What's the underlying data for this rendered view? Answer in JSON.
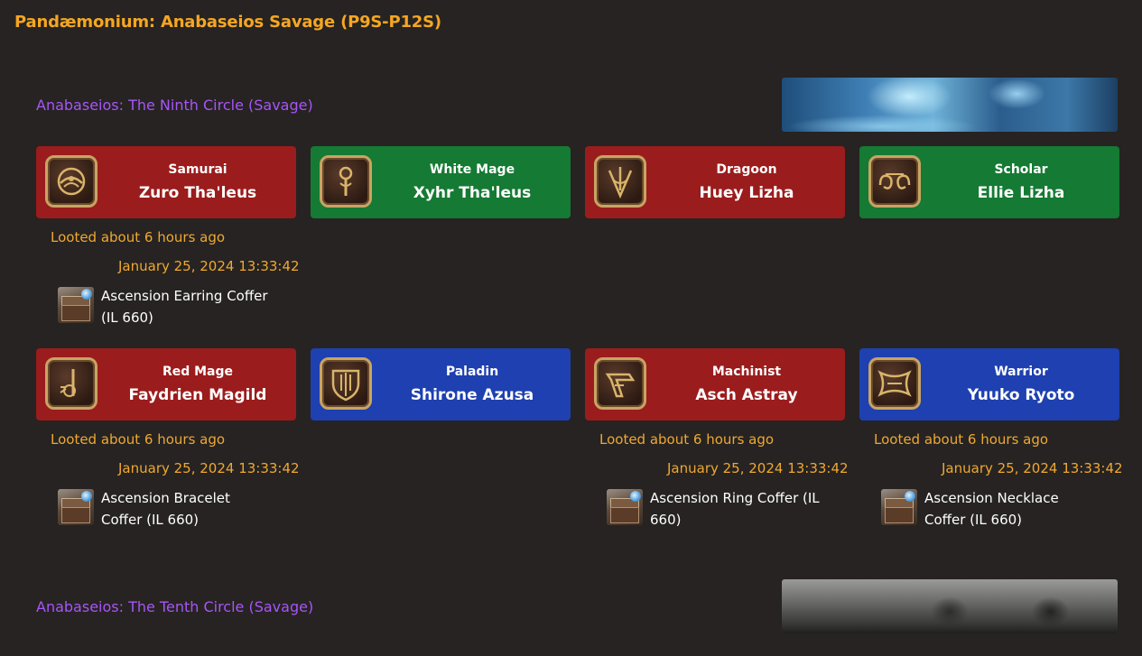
{
  "page_title": "Pandæmonium: Anabaseios Savage (P9S-P12S)",
  "sections": [
    {
      "title": "Anabaseios: The Ninth Circle (Savage)",
      "banner_icon": "ice-landscape-banner",
      "rows": [
        [
          {
            "job": "Samurai",
            "player": "Zuro Tha'leus",
            "color": "#9b1c1c",
            "icon": "samurai-icon",
            "looted": "Looted about 6 hours ago",
            "date": "January 25, 2024 13:33:42",
            "item": "Ascension Earring Coffer (IL 660)"
          },
          {
            "job": "White Mage",
            "player": "Xyhr Tha'leus",
            "color": "#157a33",
            "icon": "white-mage-icon"
          },
          {
            "job": "Dragoon",
            "player": "Huey Lizha",
            "color": "#9b1c1c",
            "icon": "dragoon-icon"
          },
          {
            "job": "Scholar",
            "player": "Ellie Lizha",
            "color": "#157a33",
            "icon": "scholar-icon"
          }
        ],
        [
          {
            "job": "Red Mage",
            "player": "Faydrien Magild",
            "color": "#9b1c1c",
            "icon": "red-mage-icon",
            "looted": "Looted about 6 hours ago",
            "date": "January 25, 2024 13:33:42",
            "item": "Ascension Bracelet Coffer (IL 660)"
          },
          {
            "job": "Paladin",
            "player": "Shirone Azusa",
            "color": "#1e40b0",
            "icon": "paladin-icon"
          },
          {
            "job": "Machinist",
            "player": "Asch Astray",
            "color": "#9b1c1c",
            "icon": "machinist-icon",
            "looted": "Looted about 6 hours ago",
            "date": "January 25, 2024 13:33:42",
            "item": "Ascension Ring Coffer (IL 660)"
          },
          {
            "job": "Warrior",
            "player": "Yuuko Ryoto",
            "color": "#1e40b0",
            "icon": "warrior-icon",
            "looted": "Looted about 6 hours ago",
            "date": "January 25, 2024 13:33:42",
            "item": "Ascension Necklace Coffer (IL 660)"
          }
        ]
      ]
    },
    {
      "title": "Anabaseios: The Tenth Circle (Savage)",
      "banner_icon": "graveyard-landscape-banner"
    }
  ],
  "colors": {
    "title": "#f5a623",
    "section": "#a855f7",
    "loot_text": "#f0a830",
    "dps": "#9b1c1c",
    "healer": "#157a33",
    "tank": "#1e40b0"
  }
}
